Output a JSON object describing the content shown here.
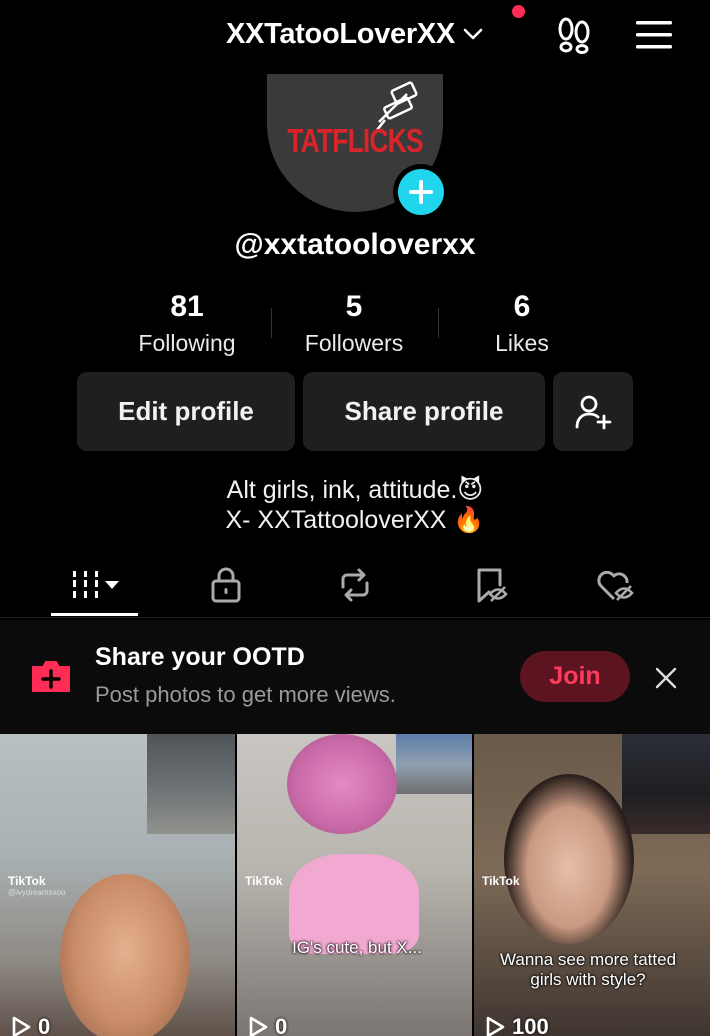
{
  "header": {
    "username": "XXTatooLoverXX"
  },
  "profile": {
    "avatar_logo_text": "TATFLICKS",
    "handle": "@xxtatooloverxx",
    "stats": [
      {
        "value": "81",
        "label": "Following"
      },
      {
        "value": "5",
        "label": "Followers"
      },
      {
        "value": "6",
        "label": "Likes"
      }
    ],
    "buttons": {
      "edit": "Edit profile",
      "share": "Share profile"
    },
    "bio": {
      "line1": "Alt girls, ink, attitude.",
      "line1_emoji": "😈",
      "line2": "X- XXTattooloverXX",
      "line2_emoji": "🔥"
    }
  },
  "tabs": [
    "videos-icon",
    "lock-icon",
    "repost-icon",
    "bookmark-icon",
    "liked-icon"
  ],
  "banner": {
    "title": "Share your OOTD",
    "subtitle": "Post photos to get more views.",
    "join_label": "Join"
  },
  "videos": [
    {
      "views": "0",
      "watermark": "TikTok",
      "watermark_user": "@ivydreamsxoo",
      "caption": ""
    },
    {
      "views": "0",
      "watermark": "TikTok",
      "watermark_user": "",
      "caption": "IG's cute, but X..."
    },
    {
      "views": "100",
      "watermark": "TikTok",
      "watermark_user": "",
      "caption": "Wanna see more tatted girls with style?"
    }
  ],
  "colors": {
    "accent": "#ff2c55",
    "avatar_add": "#20d5ec",
    "button_bg": "#1f1f1f",
    "join_bg": "#5b1420",
    "join_text": "#ff3b5c"
  }
}
